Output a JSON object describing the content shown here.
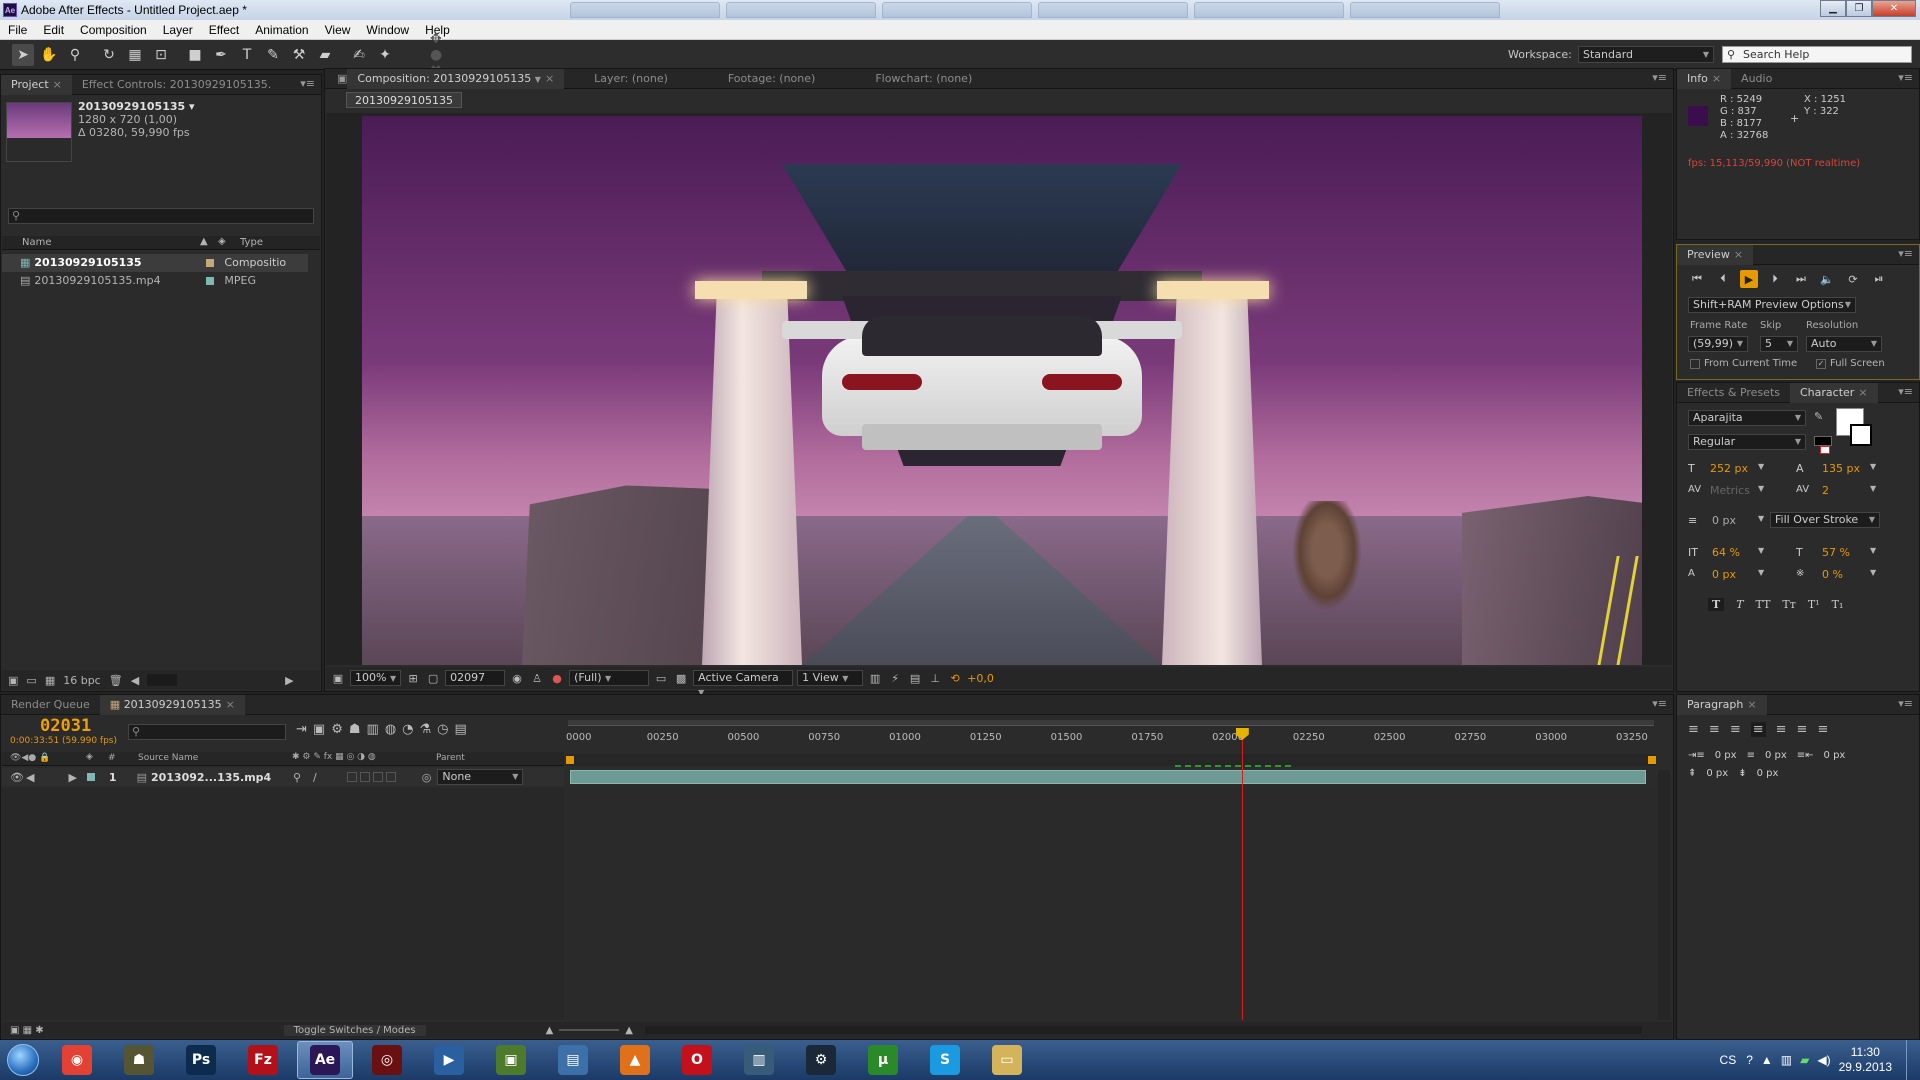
{
  "window": {
    "title": "Adobe After Effects - Untitled Project.aep *",
    "icon_text": "Ae"
  },
  "menu": [
    "File",
    "Edit",
    "Composition",
    "Layer",
    "Effect",
    "Animation",
    "View",
    "Window",
    "Help"
  ],
  "toolbar": {
    "workspace_label": "Workspace:",
    "workspace_value": "Standard",
    "search_placeholder": "Search Help"
  },
  "project_panel": {
    "tab_project": "Project",
    "tab_effect_controls": "Effect Controls: 20130929105135.",
    "item_name": "20130929105135 ▾",
    "item_info_1": "1280 x 720 (1,00)",
    "item_info_2": "Δ 03280, 59,990 fps",
    "search_placeholder": "",
    "col_name": "Name",
    "col_type": "Type",
    "rows": [
      {
        "name": "20130929105135",
        "type": "Compositio",
        "color": "#c4a97a"
      },
      {
        "name": "20130929105135.mp4",
        "type": "MPEG",
        "color": "#7fb7b2"
      }
    ],
    "bpc": "16 bpc"
  },
  "comp_panel": {
    "tab_comp": "Composition: 20130929105135",
    "tab_layer": "Layer: (none)",
    "tab_footage": "Footage: (none)",
    "tab_flowchart": "Flowchart: (none)",
    "comp_chip": "20130929105135",
    "zoom": "100%",
    "frame": "02097",
    "resolution": "(Full)",
    "camera": "Active Camera",
    "views": "1 View",
    "exposure": "+0,0"
  },
  "timeline": {
    "tab_render_queue": "Render Queue",
    "tab_comp": "20130929105135",
    "timecode": "02031",
    "timecode_sub": "0:00:33:51 (59.990 fps)",
    "col_source": "Source Name",
    "col_parent": "Parent",
    "layer_number": "1",
    "layer_name": "2013092...135.mp4",
    "layer_parent": "None",
    "ruler_labels": [
      "0000",
      "00250",
      "00500",
      "00750",
      "01000",
      "01250",
      "01500",
      "01750",
      "02000",
      "02250",
      "02500",
      "02750",
      "03000",
      "03250"
    ],
    "current_time_fraction": 0.62,
    "toggle_label": "Toggle Switches / Modes"
  },
  "info_panel": {
    "tab_info": "Info",
    "tab_audio": "Audio",
    "r": "R : 5249",
    "g": "G : 837",
    "b": "B : 8177",
    "a": "A : 32768",
    "x": "X : 1251",
    "y": "Y : 322",
    "fps": "fps: 15,113/59,990 (NOT realtime)",
    "swatch_color": "#3a0d4d"
  },
  "preview_panel": {
    "tab": "Preview",
    "ram_options": "Shift+RAM Preview Options",
    "frame_rate_label": "Frame Rate",
    "skip_label": "Skip",
    "resolution_label": "Resolution",
    "frame_rate_value": "(59,99)",
    "skip_value": "5",
    "resolution_value": "Auto",
    "from_current_time": "From Current Time",
    "full_screen": "Full Screen"
  },
  "character_panel": {
    "tab_effects": "Effects & Presets",
    "tab_character": "Character",
    "font": "Aparajita",
    "style": "Regular",
    "size": "252 px",
    "leading": "135 px",
    "kerning": "Metrics",
    "tracking": "2",
    "stroke": "0 px",
    "stroke_mode": "Fill Over Stroke",
    "vscale": "64 %",
    "hscale": "57 %",
    "baseline": "0 px",
    "tsume": "0 %"
  },
  "paragraph_panel": {
    "tab": "Paragraph",
    "indent_left": "0 px",
    "indent_first": "0 px",
    "indent_right": "0 px",
    "space_before": "0 px",
    "space_after": "0 px"
  },
  "taskbar": {
    "apps": [
      {
        "name": "chrome",
        "label": "◉",
        "color": "#e34133"
      },
      {
        "name": "game",
        "label": "☗",
        "color": "#553"
      },
      {
        "name": "photoshop",
        "label": "Ps",
        "color": "#0c2b4d"
      },
      {
        "name": "filezilla",
        "label": "Fz",
        "color": "#b3101a"
      },
      {
        "name": "aftereffects",
        "label": "Ae",
        "color": "#2b1755"
      },
      {
        "name": "app-red",
        "label": "◎",
        "color": "#6b1010"
      },
      {
        "name": "media-player",
        "label": "▶",
        "color": "#2a5fa0"
      },
      {
        "name": "minecraft",
        "label": "▣",
        "color": "#4e7a2c"
      },
      {
        "name": "network",
        "label": "▤",
        "color": "#3d6fa8"
      },
      {
        "name": "vlc",
        "label": "▲",
        "color": "#e0701a"
      },
      {
        "name": "opera",
        "label": "O",
        "color": "#c3101a"
      },
      {
        "name": "window-app",
        "label": "▥",
        "color": "#365c7a"
      },
      {
        "name": "steam",
        "label": "⚙",
        "color": "#1b2838"
      },
      {
        "name": "utorrent",
        "label": "µ",
        "color": "#2a8a2a"
      },
      {
        "name": "skype",
        "label": "S",
        "color": "#1a9ae0"
      },
      {
        "name": "explorer",
        "label": "▭",
        "color": "#d5b35a"
      }
    ],
    "lang": "CS",
    "time": "11:30",
    "date": "29.9.2013"
  }
}
